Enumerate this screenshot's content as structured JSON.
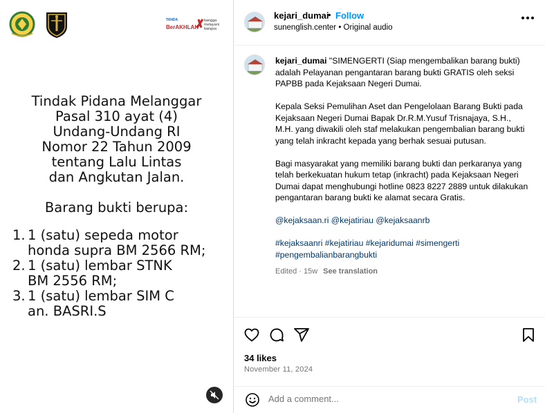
{
  "media": {
    "title": "Tindak Pidana Melanggar\nPasal 310 ayat (4)\nUndang-Undang RI\nNomor 22 Tahun 2009\ntentang Lalu Lintas\n dan Angkutan Jalan.",
    "subtitle": "Barang bukti berupa:",
    "items": [
      {
        "num": "1.",
        "text": "1 (satu) sepeda motor\n honda supra BM 2566 RM;"
      },
      {
        "num": "2.",
        "text": "1 (satu) lembar STNK\n BM 2556 RM;"
      },
      {
        "num": "3.",
        "text": "1 (satu) lembar SIM C\n an. BASRI.S"
      }
    ],
    "logo_right_lines": [
      "BerAKHLAK",
      "bangga melayani bangsa"
    ],
    "logo_right_small": "Tanda\nBerakhlak",
    "mute_icon": "muted-speaker-icon"
  },
  "header": {
    "username": "kejari_dumai",
    "dot": "•",
    "follow": "Follow",
    "subtitle": "sunenglish.center • Original audio",
    "more_icon": "more-horizontal-icon"
  },
  "caption": {
    "username": "kejari_dumai",
    "p1": "\"SIMENGERTI (Siap mengembalikan barang bukti) adalah Pelayanan pengantaran barang bukti GRATIS oleh seksi PAPBB pada Kejaksaan Negeri Dumai.",
    "p2": "Kepala Seksi Pemulihan Aset dan Pengelolaan Barang Bukti pada Kejaksaan Negeri Dumai Bapak Dr.R.M.Yusuf Trisnajaya, S.H., M.H. yang diwakili oleh staf melakukan pengembalian barang bukti yang telah inkracht kepada yang berhak sesuai putusan.",
    "p3": "Bagi masyarakat yang memiliki barang bukti dan perkaranya yang telah berkekuatan hukum tetap (inkracht) pada Kejaksaan Negeri Dumai dapat menghubungi hotline 0823 8227 2889 untuk dilakukan pengantaran barang bukti ke alamat secara Gratis.",
    "mentions": "@kejaksaan.ri @kejatiriau @kejaksaanrb",
    "hashtags": "#kejaksaanri #kejatiriau #kejaridumai #simengerti #pengembalianbarangbukti",
    "meta": "Edited · 15w",
    "see_translation": "See translation"
  },
  "actions": {
    "like_icon": "heart-icon",
    "comment_icon": "comment-icon",
    "share_icon": "share-icon",
    "save_icon": "bookmark-icon",
    "likes": "34 likes",
    "date": "November 11, 2024"
  },
  "comment": {
    "emoji_icon": "emoji-icon",
    "placeholder": "Add a comment...",
    "post": "Post"
  },
  "colors": {
    "link": "#00376b",
    "follow": "#0095f6",
    "post_disabled": "#b2dffc",
    "muted": "#737373"
  }
}
